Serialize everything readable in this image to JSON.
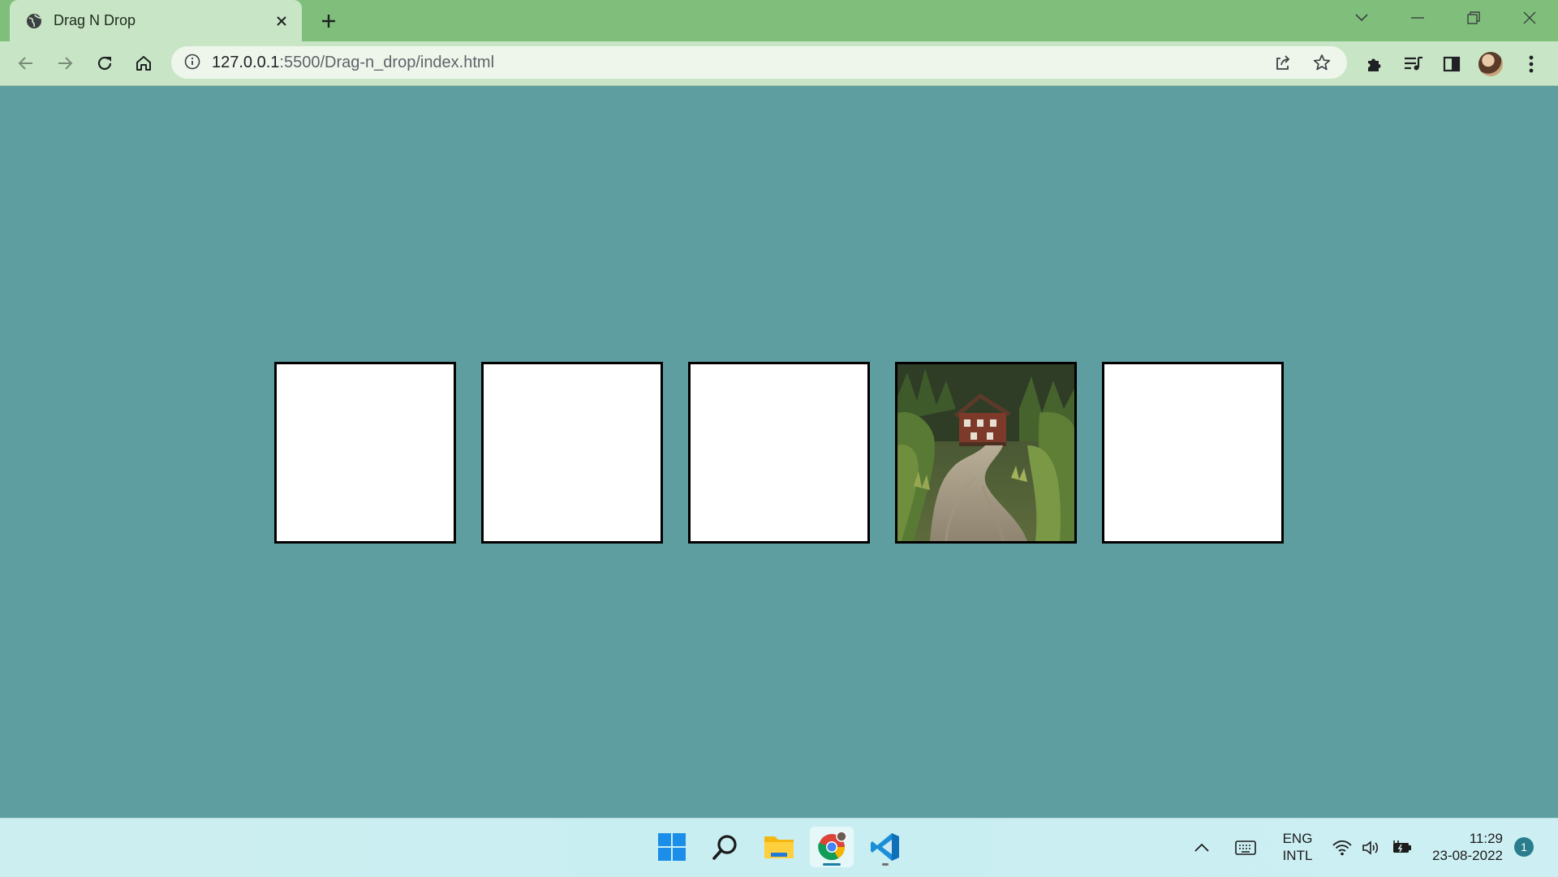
{
  "browser": {
    "tab_title": "Drag N Drop",
    "url_host": "127.0.0.1",
    "url_path": ":5500/Drag-n_drop/index.html",
    "colors": {
      "tabstrip": "#7fbf7b",
      "toolbar": "#c8e6c5",
      "page_background": "#5f9ea0"
    }
  },
  "drop_zones": [
    {
      "id": 1,
      "filled": false
    },
    {
      "id": 2,
      "filled": false
    },
    {
      "id": 3,
      "filled": false
    },
    {
      "id": 4,
      "filled": true,
      "content": "cabin-path-image"
    },
    {
      "id": 5,
      "filled": false
    }
  ],
  "taskbar": {
    "apps": [
      "windows-start-icon",
      "search-icon",
      "file-explorer-icon",
      "chrome-icon",
      "vscode-icon"
    ],
    "lang_top": "ENG",
    "lang_bottom": "INTL",
    "time": "11:29",
    "date": "23-08-2022",
    "notification_count": "1"
  }
}
